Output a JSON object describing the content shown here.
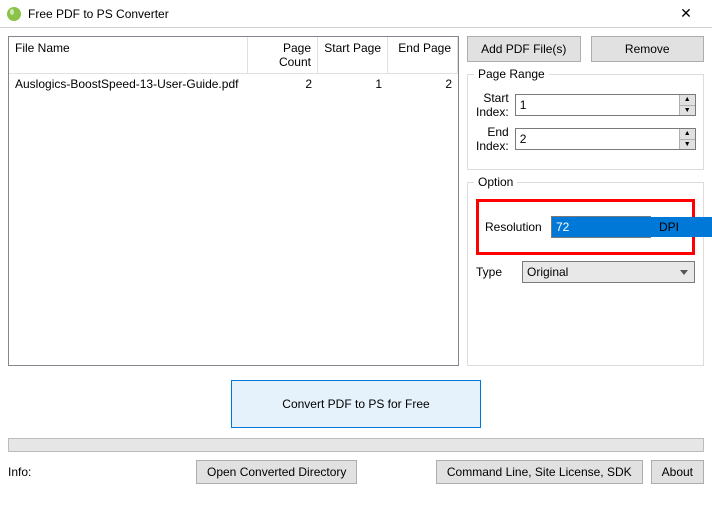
{
  "window": {
    "title": "Free PDF to PS Converter"
  },
  "table": {
    "headers": {
      "fileName": "File Name",
      "pageCount": "Page Count",
      "startPage": "Start Page",
      "endPage": "End Page"
    },
    "rows": [
      {
        "fileName": "Auslogics-BoostSpeed-13-User-Guide.pdf",
        "pageCount": "2",
        "startPage": "1",
        "endPage": "2"
      }
    ]
  },
  "buttons": {
    "addPdf": "Add PDF File(s)",
    "remove": "Remove",
    "convert": "Convert PDF to PS for Free",
    "openDir": "Open Converted Directory",
    "cmdLine": "Command Line, Site License, SDK",
    "about": "About"
  },
  "pageRange": {
    "title": "Page Range",
    "startLabel": "Start Index:",
    "startValue": "1",
    "endLabel": "End Index:",
    "endValue": "2"
  },
  "option": {
    "title": "Option",
    "resLabel": "Resolution",
    "resValue": "72",
    "resUnit": "DPI",
    "typeLabel": "Type",
    "typeValue": "Original"
  },
  "footer": {
    "info": "Info:"
  }
}
